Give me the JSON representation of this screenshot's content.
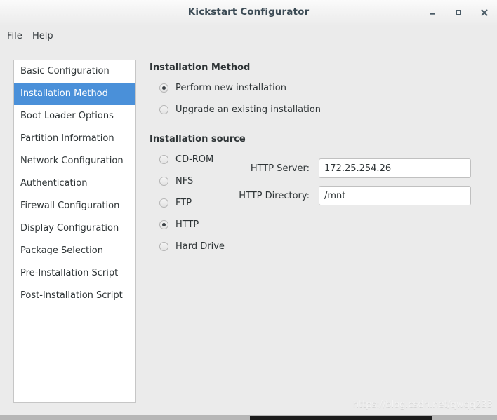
{
  "window": {
    "title": "Kickstart Configurator",
    "buttons": {
      "minimize": "minimize-icon",
      "maximize": "maximize-icon",
      "close": "close-icon"
    }
  },
  "menubar": {
    "items": [
      {
        "label": "File"
      },
      {
        "label": "Help"
      }
    ]
  },
  "sidebar": {
    "items": [
      {
        "label": "Basic Configuration",
        "selected": false
      },
      {
        "label": "Installation Method",
        "selected": true
      },
      {
        "label": "Boot Loader Options",
        "selected": false
      },
      {
        "label": "Partition Information",
        "selected": false
      },
      {
        "label": "Network Configuration",
        "selected": false
      },
      {
        "label": "Authentication",
        "selected": false
      },
      {
        "label": "Firewall Configuration",
        "selected": false
      },
      {
        "label": "Display Configuration",
        "selected": false
      },
      {
        "label": "Package Selection",
        "selected": false
      },
      {
        "label": "Pre-Installation Script",
        "selected": false
      },
      {
        "label": "Post-Installation Script",
        "selected": false
      }
    ],
    "selected_color": "#4a90d9"
  },
  "main": {
    "installation_method": {
      "heading": "Installation Method",
      "options": [
        {
          "label": "Perform new installation",
          "checked": true
        },
        {
          "label": "Upgrade an existing installation",
          "checked": false
        }
      ]
    },
    "installation_source": {
      "heading": "Installation source",
      "options": [
        {
          "label": "CD-ROM",
          "checked": false
        },
        {
          "label": "NFS",
          "checked": false
        },
        {
          "label": "FTP",
          "checked": false
        },
        {
          "label": "HTTP",
          "checked": true
        },
        {
          "label": "Hard Drive",
          "checked": false
        }
      ],
      "fields": [
        {
          "label": "HTTP Server:",
          "value": "172.25.254.26"
        },
        {
          "label": "HTTP Directory:",
          "value": "/mnt"
        }
      ]
    }
  },
  "watermark": {
    "text": "https://blog.csdn.net/qwqq233"
  }
}
